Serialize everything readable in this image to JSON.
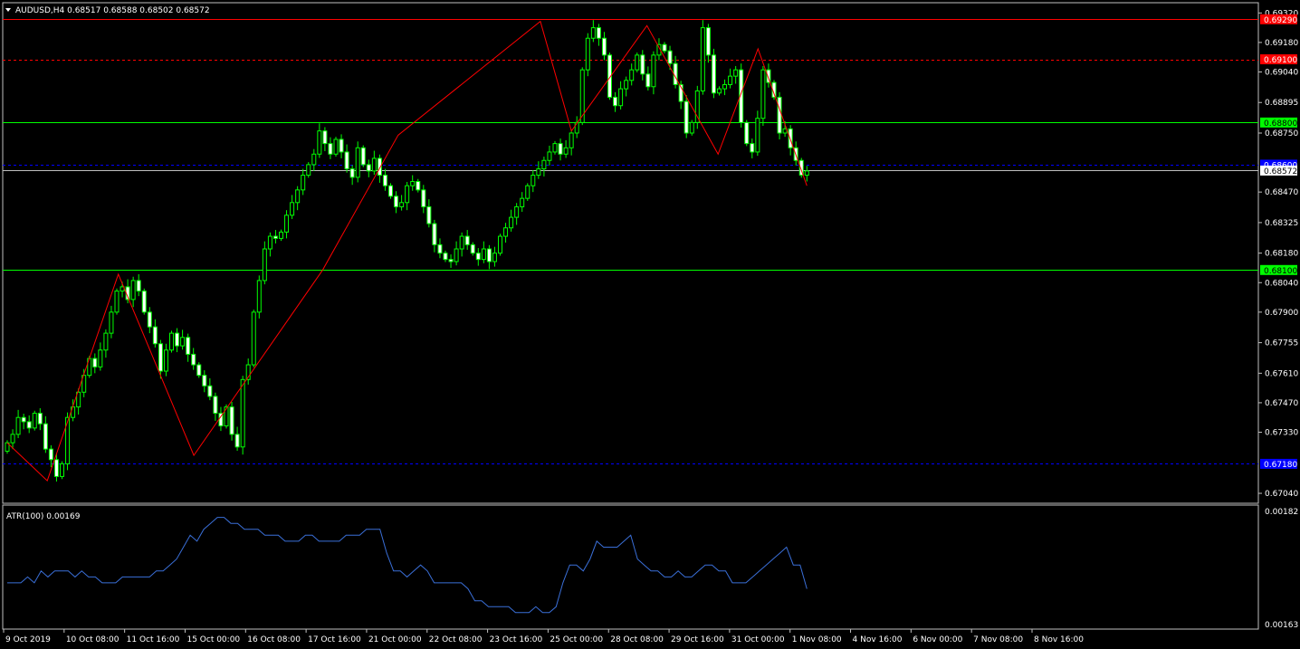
{
  "symbol_header": "AUDUSD,H4  0.68517 0.68588 0.68502 0.68572",
  "indicator_header": "ATR(100) 0.00169",
  "colors": {
    "background": "#000000",
    "frame": "#c0c0c0",
    "candle_bull": "#000000",
    "candle_bear": "#ffffff",
    "candle_wick": "#00ff00",
    "zigzag": "#ff0000",
    "level_green": "#00ff00",
    "level_red": "#ff0000",
    "level_blue": "#0000ff",
    "atr_line": "#3a6fd8"
  },
  "price_axis": {
    "ticks": [
      "0.69320",
      "0.69180",
      "0.69040",
      "0.68895",
      "0.68750",
      "0.68470",
      "0.68325",
      "0.68180",
      "0.68040",
      "0.67900",
      "0.67755",
      "0.67610",
      "0.67470",
      "0.67330",
      "0.67040"
    ]
  },
  "atr_axis": {
    "ticks": [
      "0.00182",
      "0.00163"
    ]
  },
  "time_axis": {
    "labels": [
      "9 Oct 2019",
      "10 Oct 08:00",
      "11 Oct 16:00",
      "15 Oct 00:00",
      "16 Oct 08:00",
      "17 Oct 16:00",
      "21 Oct 00:00",
      "22 Oct 08:00",
      "23 Oct 16:00",
      "25 Oct 00:00",
      "28 Oct 08:00",
      "29 Oct 16:00",
      "31 Oct 00:00",
      "1 Nov 08:00",
      "4 Nov 16:00",
      "6 Nov 00:00",
      "7 Nov 08:00",
      "8 Nov 16:00"
    ]
  },
  "levels": [
    {
      "name": "red-solid-level",
      "price": 0.6929,
      "style": "solid",
      "color": "#ff0000",
      "tag": "0.69290",
      "tag_bg": "#ff0000"
    },
    {
      "name": "red-dashed-level",
      "price": 0.691,
      "style": "dashed",
      "color": "#ff0000",
      "tag": "0.69100",
      "tag_bg": "#ff0000"
    },
    {
      "name": "green-upper-level",
      "price": 0.688,
      "style": "solid",
      "color": "#00ff00",
      "tag": "0.68800",
      "tag_bg": "#00ff00"
    },
    {
      "name": "blue-upper-level",
      "price": 0.686,
      "style": "dashed",
      "color": "#0000ff",
      "tag": "0.68600",
      "tag_bg": "#0000ff"
    },
    {
      "name": "bid-line",
      "price": 0.68572,
      "style": "solid",
      "color": "#c0c0c0",
      "tag": "0.68572",
      "tag_bg": "#ffffff"
    },
    {
      "name": "green-lower-level",
      "price": 0.681,
      "style": "solid",
      "color": "#00ff00",
      "tag": "0.68100",
      "tag_bg": "#00ff00"
    },
    {
      "name": "blue-lower-level",
      "price": 0.6718,
      "style": "dashed",
      "color": "#0000ff",
      "tag": "0.67180",
      "tag_bg": "#0000ff"
    }
  ],
  "chart_data": {
    "type": "candlestick",
    "symbol": "AUDUSD",
    "timeframe": "H4",
    "ylim": [
      0.6701,
      0.6936
    ],
    "x_count": 140,
    "closes": [
      0.6728,
      0.6732,
      0.674,
      0.6738,
      0.6735,
      0.6742,
      0.6737,
      0.6725,
      0.672,
      0.6712,
      0.6718,
      0.674,
      0.6745,
      0.6752,
      0.676,
      0.6768,
      0.6764,
      0.6772,
      0.678,
      0.679,
      0.68,
      0.6802,
      0.6796,
      0.6805,
      0.68,
      0.679,
      0.6783,
      0.6775,
      0.6762,
      0.6772,
      0.678,
      0.6774,
      0.6778,
      0.677,
      0.6765,
      0.676,
      0.6755,
      0.675,
      0.6742,
      0.6736,
      0.6745,
      0.6732,
      0.6726,
      0.6758,
      0.6765,
      0.679,
      0.6805,
      0.682,
      0.6826,
      0.6825,
      0.6828,
      0.6836,
      0.6842,
      0.6848,
      0.6855,
      0.686,
      0.6865,
      0.6876,
      0.687,
      0.6865,
      0.6872,
      0.6866,
      0.6858,
      0.6854,
      0.6868,
      0.686,
      0.6857,
      0.6863,
      0.6855,
      0.685,
      0.6845,
      0.684,
      0.6842,
      0.685,
      0.6852,
      0.6848,
      0.684,
      0.6832,
      0.6822,
      0.6818,
      0.6815,
      0.6814,
      0.682,
      0.6826,
      0.6822,
      0.6818,
      0.6815,
      0.682,
      0.6814,
      0.6818,
      0.6826,
      0.683,
      0.6835,
      0.684,
      0.6844,
      0.685,
      0.6855,
      0.6858,
      0.6862,
      0.6866,
      0.687,
      0.6865,
      0.6868,
      0.6875,
      0.688,
      0.6905,
      0.692,
      0.6925,
      0.692,
      0.6912,
      0.6892,
      0.6888,
      0.6896,
      0.69,
      0.6905,
      0.6912,
      0.6903,
      0.6897,
      0.6912,
      0.6917,
      0.6914,
      0.6908,
      0.6898,
      0.689,
      0.6875,
      0.688,
      0.6895,
      0.6925,
      0.6912,
      0.6894,
      0.6896,
      0.6898,
      0.6902,
      0.6905,
      0.688,
      0.687,
      0.6866,
      0.6882,
      0.6905,
      0.6899,
      0.6892,
      0.6875,
      0.6877,
      0.6868,
      0.6862,
      0.6855,
      0.6857
    ],
    "zigzag_points": [
      [
        0,
        0.6728
      ],
      [
        9,
        0.671
      ],
      [
        25,
        0.6808
      ],
      [
        42,
        0.6722
      ],
      [
        88,
        0.6874
      ],
      [
        71,
        0.681
      ],
      [
        120,
        0.6928
      ],
      [
        127,
        0.6876
      ],
      [
        144,
        0.6926
      ],
      [
        160,
        0.6865
      ],
      [
        169,
        0.6915
      ],
      [
        180,
        0.685
      ]
    ],
    "atr": {
      "name": "ATR(100)",
      "last_value": 0.00169,
      "ylim": [
        0.00163,
        0.00182
      ],
      "values": [
        0.0017,
        0.0017,
        0.0017,
        0.00171,
        0.0017,
        0.00172,
        0.00171,
        0.00172,
        0.00172,
        0.00172,
        0.00171,
        0.00172,
        0.00171,
        0.00171,
        0.0017,
        0.0017,
        0.0017,
        0.00171,
        0.00171,
        0.00171,
        0.00171,
        0.00171,
        0.00172,
        0.00172,
        0.00173,
        0.00174,
        0.00176,
        0.00178,
        0.00177,
        0.00179,
        0.0018,
        0.00181,
        0.00181,
        0.0018,
        0.0018,
        0.00179,
        0.00179,
        0.00179,
        0.00178,
        0.00178,
        0.00178,
        0.00177,
        0.00177,
        0.00177,
        0.00178,
        0.00178,
        0.00177,
        0.00177,
        0.00177,
        0.00177,
        0.00178,
        0.00178,
        0.00178,
        0.00179,
        0.00179,
        0.00179,
        0.00175,
        0.00172,
        0.00172,
        0.00171,
        0.00172,
        0.00173,
        0.00172,
        0.0017,
        0.0017,
        0.0017,
        0.0017,
        0.0017,
        0.00169,
        0.00167,
        0.00167,
        0.00166,
        0.00166,
        0.00166,
        0.00166,
        0.00165,
        0.00165,
        0.00165,
        0.00166,
        0.00165,
        0.00165,
        0.00166,
        0.0017,
        0.00173,
        0.00173,
        0.00172,
        0.00174,
        0.00177,
        0.00176,
        0.00176,
        0.00176,
        0.00177,
        0.00178,
        0.00174,
        0.00173,
        0.00172,
        0.00172,
        0.00171,
        0.00171,
        0.00172,
        0.00171,
        0.00171,
        0.00172,
        0.00173,
        0.00173,
        0.00172,
        0.00172,
        0.0017,
        0.0017,
        0.0017,
        0.00171,
        0.00172,
        0.00173,
        0.00174,
        0.00175,
        0.00176,
        0.00173,
        0.00173,
        0.00169
      ]
    }
  }
}
